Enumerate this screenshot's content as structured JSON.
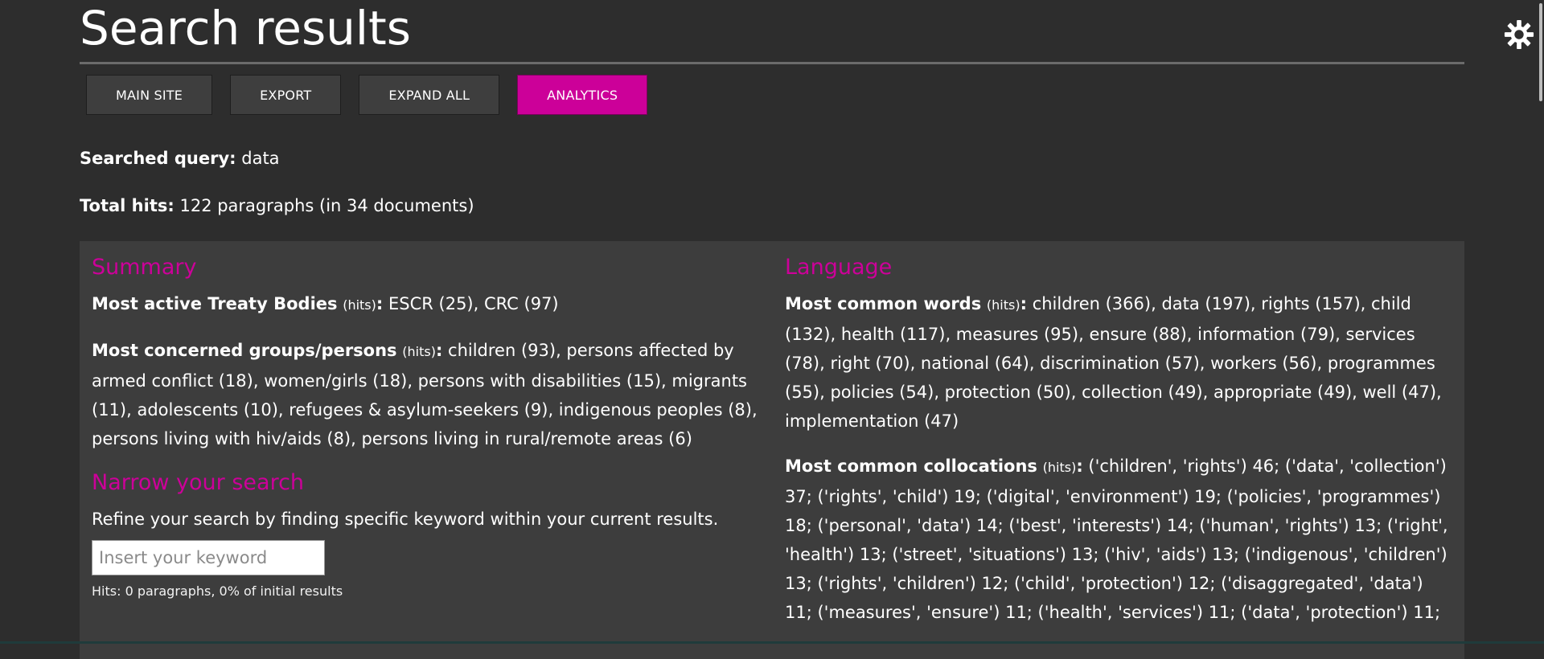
{
  "header": {
    "title": "Search results"
  },
  "toolbar": {
    "buttons": [
      {
        "label": "MAIN SITE"
      },
      {
        "label": "EXPORT"
      },
      {
        "label": "EXPAND ALL"
      },
      {
        "label": "ANALYTICS",
        "active": true
      }
    ]
  },
  "query": {
    "label": "Searched query:",
    "value": "data"
  },
  "total": {
    "label": "Total hits:",
    "value": "122 paragraphs (in 34 documents)"
  },
  "summary": {
    "heading": "Summary",
    "treaty_label": "Most active Treaty Bodies",
    "treaty_hits": "(hits)",
    "treaty_value": "ESCR (25), CRC (97)",
    "groups_label": "Most concerned groups/persons",
    "groups_hits": "(hits)",
    "groups_value": "children (93), persons affected by armed conflict (18), women/girls (18), persons with disabilities (15), migrants (11), adolescents (10), refugees & asylum-seekers (9), indigenous peoples (8), persons living with hiv/aids (8), persons living in rural/remote areas (6)"
  },
  "narrow": {
    "heading": "Narrow your search",
    "description": "Refine your search by finding specific keyword within your current results.",
    "placeholder": "Insert your keyword",
    "hits_note": "Hits: 0 paragraphs, 0% of initial results"
  },
  "language": {
    "heading": "Language",
    "words_label": "Most common words",
    "words_hits": "(hits)",
    "words_value": "children (366), data (197), rights (157), child (132), health (117), measures (95), ensure (88), information (79), services (78), right (70), national (64), discrimination (57), workers (56), programmes (55), policies (54), protection (50), collection (49), appropriate (49), well (47), implementation (47)",
    "colloc_label": "Most common collocations",
    "colloc_hits": "(hits)",
    "colloc_value": "('children', 'rights') 46; ('data', 'collection') 37; ('rights', 'child') 19; ('digital', 'environment') 19; ('policies', 'programmes') 18; ('personal', 'data') 14; ('best', 'interests') 14; ('human', 'rights') 13; ('right', 'health') 13; ('street', 'situations') 13; ('hiv', 'aids') 13; ('indigenous', 'children') 13; ('rights', 'children') 12; ('child', 'protection') 12; ('disaggregated', 'data') 11; ('measures', 'ensure') 11; ('health', 'services') 11; ('data', 'protection') 11;"
  },
  "icons": {
    "theme_toggle": "gear-icon"
  },
  "colors": {
    "accent": "#cc0099",
    "background": "#2d2d2d",
    "panel": "#3d3d3d"
  }
}
